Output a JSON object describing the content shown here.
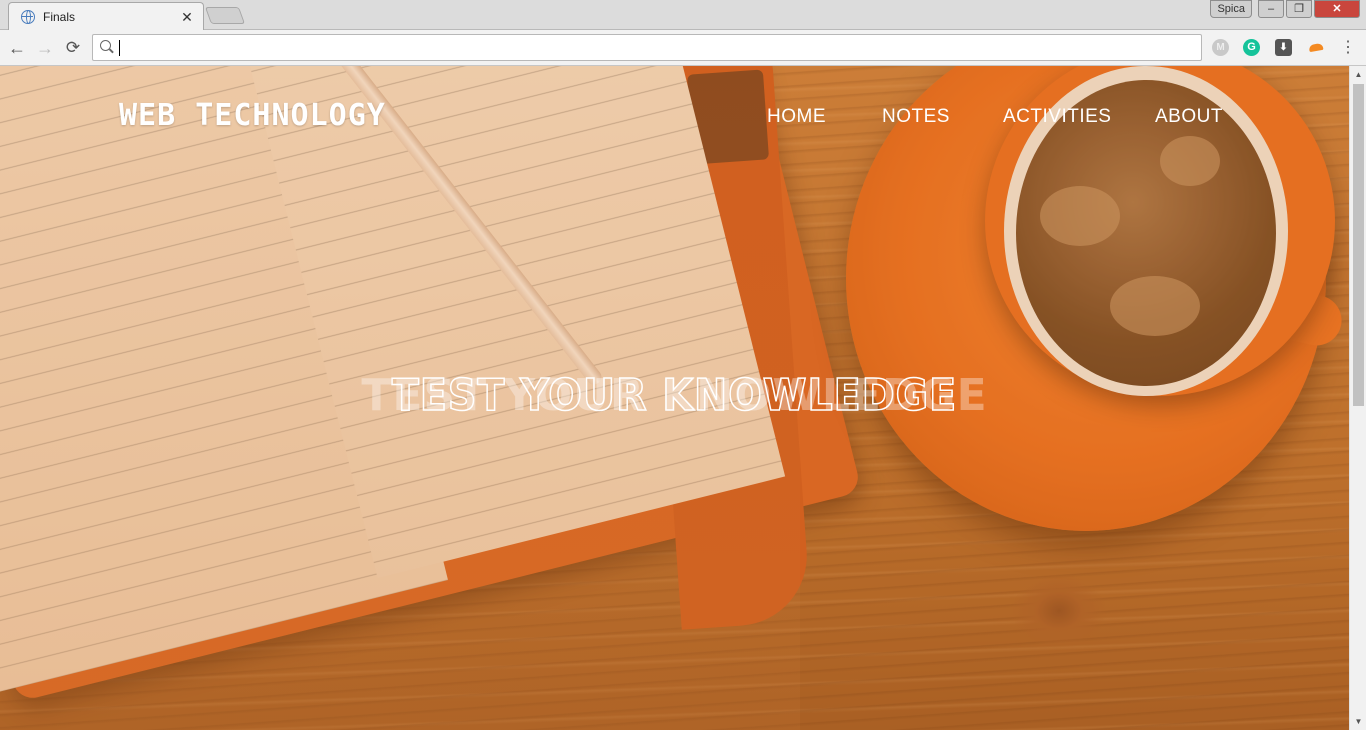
{
  "browser": {
    "tab": {
      "title": "Finals",
      "close": "✕"
    },
    "profile": "Spica",
    "window_controls": {
      "minimize": "‒",
      "restore": "❐",
      "close": "✕"
    },
    "nav": {
      "back": "←",
      "forward": "→",
      "reload": "⟳"
    },
    "omnibox": {
      "value": "",
      "placeholder": ""
    },
    "extensions": [
      "mendeley-icon",
      "grammarly-icon",
      "download-icon",
      "orange-extension-icon"
    ],
    "menu": "⋮"
  },
  "site": {
    "title": "WEB TECHNOLOGY",
    "nav": [
      "HOME",
      "NOTES",
      "ACTIVITIES",
      "ABOUT"
    ],
    "hero": "TEST YOUR KNOWLEDGE"
  },
  "colors": {
    "accent_orange": "#e86a1c",
    "wood": "#c87c3a",
    "text": "#ffffff"
  },
  "scrollbar": {
    "up": "▲",
    "down": "▼"
  }
}
